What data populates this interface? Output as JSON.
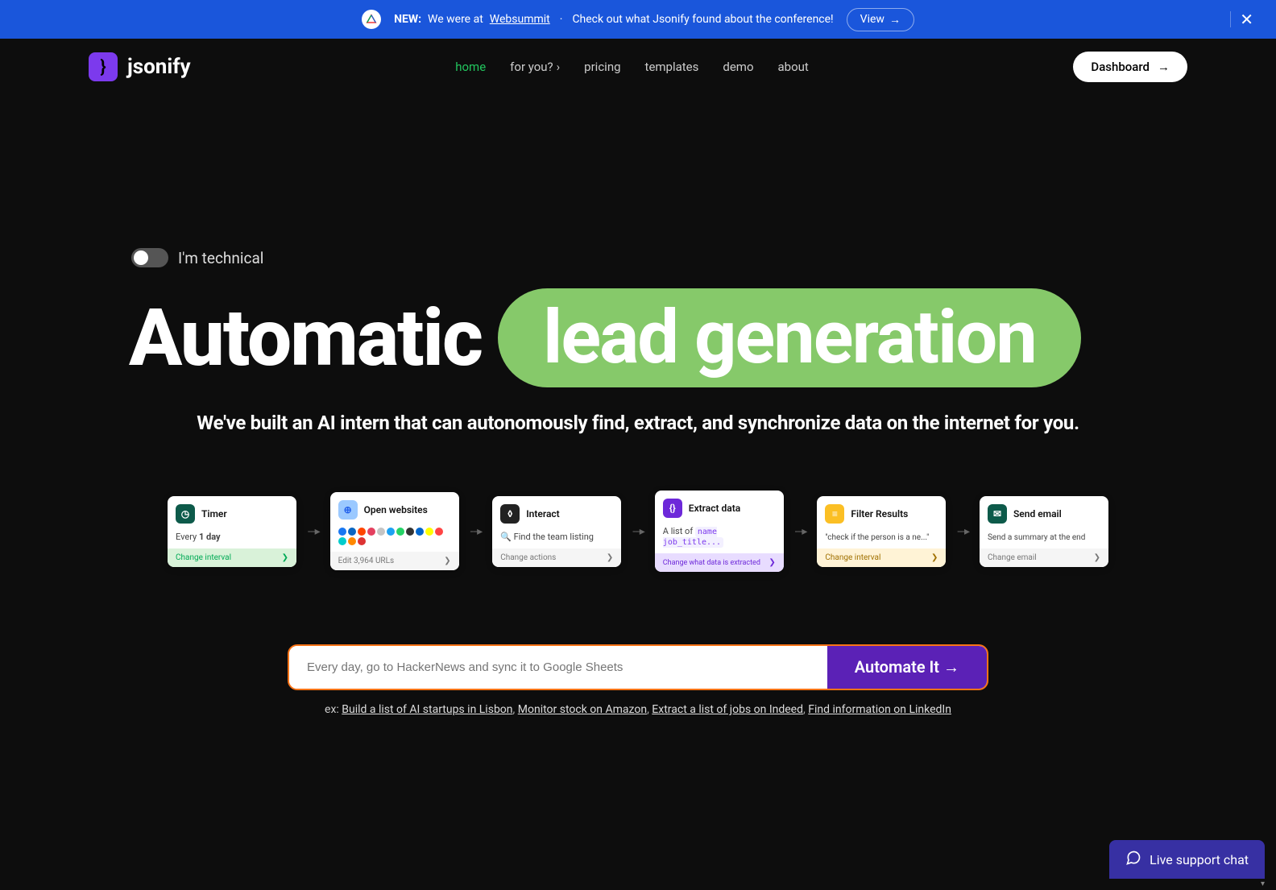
{
  "banner": {
    "new_label": "NEW:",
    "text1": "We were at",
    "link_text": "Websummit",
    "dot": "·",
    "text2": "Check out what Jsonify found about the conference!",
    "view_label": "View",
    "close": "✕"
  },
  "nav": {
    "brand": "jsonify",
    "logo_glyph": "}",
    "links": {
      "home": "home",
      "foryou": "for you?",
      "pricing": "pricing",
      "templates": "templates",
      "demo": "demo",
      "about": "about"
    },
    "dashboard": "Dashboard"
  },
  "hero": {
    "toggle_label": "I'm technical",
    "headline_static": "Automatic",
    "headline_dynamic": "lead generation",
    "subheadline": "We've built an AI intern that can autonomously find, extract, and synchronize data on the internet for you."
  },
  "workflow": [
    {
      "icon": "timer-icon",
      "title": "Timer",
      "body_prefix": "Every ",
      "body_bold": "1 day",
      "footer": "Change interval",
      "foot_class": "ft-green"
    },
    {
      "icon": "open-websites-icon",
      "title": "Open websites",
      "body_type": "logos",
      "footer": "Edit 3,964 URLs",
      "foot_class": "ft-plain"
    },
    {
      "icon": "interact-icon",
      "title": "Interact",
      "body_prefix": "🔍 Find the team listing",
      "footer": "Change actions",
      "foot_class": "ft-plain"
    },
    {
      "icon": "extract-icon",
      "title": "Extract data",
      "body_prefix": "A list of ",
      "body_code": "name job_title...",
      "footer": "Change what data is extracted",
      "foot_class": "ft-purple"
    },
    {
      "icon": "filter-icon",
      "title": "Filter Results",
      "body_prefix": "\"check if the person is a ne...\"",
      "footer": "Change interval",
      "foot_class": "ft-yellow"
    },
    {
      "icon": "email-icon",
      "title": "Send email",
      "body_prefix": "Send a summary at the end",
      "footer": "Change email",
      "foot_class": "ft-plain"
    }
  ],
  "prompt": {
    "placeholder": "Every day, go to HackerNews and sync it to Google Sheets",
    "button": "Automate It →"
  },
  "examples": {
    "prefix": "ex:",
    "items": [
      "Build a list of AI startups in Lisbon",
      "Monitor stock on Amazon",
      "Extract a list of jobs on Indeed",
      "Find information on LinkedIn"
    ],
    "sep": ", "
  },
  "chat": {
    "label": "Live support chat"
  },
  "logo_colors": [
    "#1877f2",
    "#0a66c2",
    "#ff4500",
    "#e4405f",
    "#c4c4c4",
    "#1da1f2",
    "#25d366",
    "#333",
    "#06c",
    "#ff0",
    "#f44",
    "#0cc",
    "#f80",
    "#d33"
  ]
}
